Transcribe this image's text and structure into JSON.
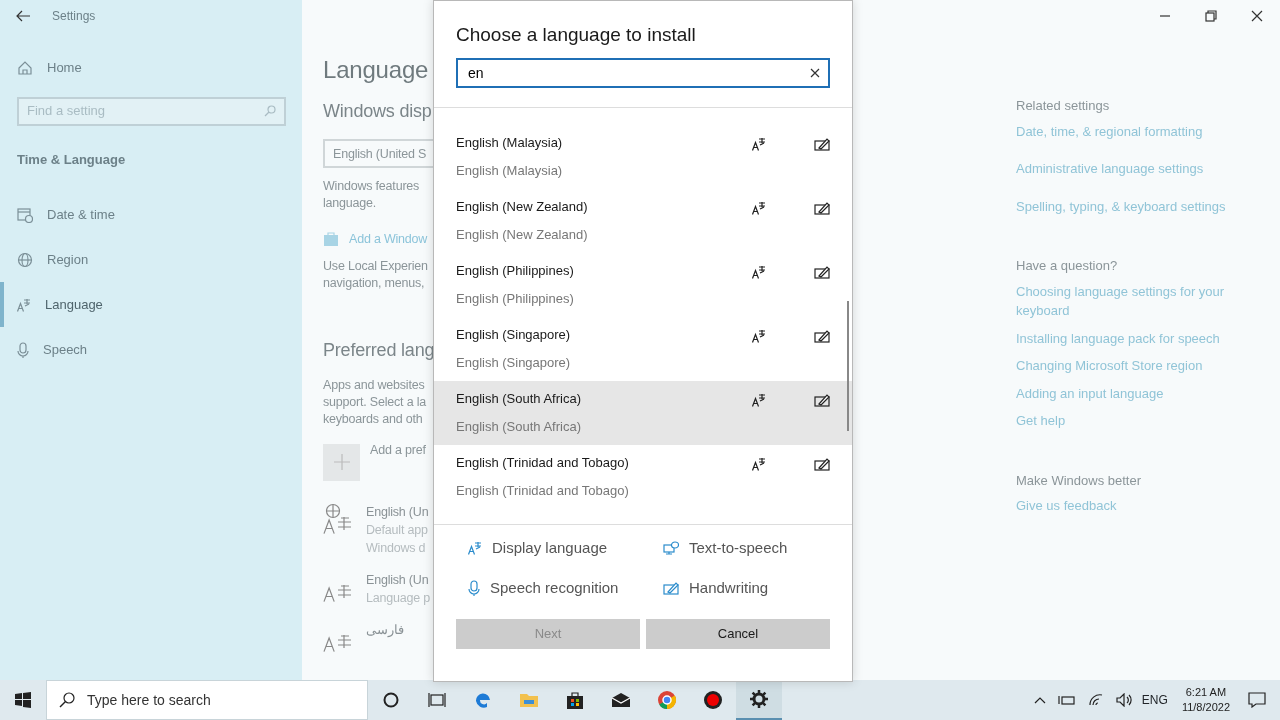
{
  "window": {
    "title": "Settings"
  },
  "sidebar": {
    "home": "Home",
    "search_placeholder": "Find a setting",
    "section": "Time & Language",
    "items": [
      {
        "label": "Date & time",
        "selected": false
      },
      {
        "label": "Region",
        "selected": false
      },
      {
        "label": "Language",
        "selected": true
      },
      {
        "label": "Speech",
        "selected": false
      }
    ]
  },
  "main": {
    "title": "Language",
    "display_heading": "Windows disp",
    "display_value": "English (United S",
    "display_note": [
      "Windows features",
      "language."
    ],
    "store_link": "Add a Window",
    "store_note": [
      "Use Local Experien",
      "navigation, menus,"
    ],
    "preferred_heading": "Preferred lang",
    "preferred_note": [
      "Apps and websites",
      "support. Select a la",
      "keyboards and oth"
    ],
    "add_label": "Add a pref",
    "preferred": [
      {
        "name": "English (Un",
        "lines": [
          "Default app",
          "Windows d"
        ]
      },
      {
        "name": "English (Un",
        "lines": [
          "Language p"
        ]
      },
      {
        "name": "فارسی"
      }
    ]
  },
  "related": [
    {
      "heading": "Related settings",
      "links": [
        "Date, time, & regional formatting",
        "Administrative language settings",
        "Spelling, typing, & keyboard settings"
      ]
    },
    {
      "heading": "Have a question?",
      "links": [
        "Choosing language settings for your keyboard",
        "Installing language pack for speech",
        "Changing Microsoft Store region",
        "Adding an input language",
        "Get help"
      ]
    },
    {
      "heading": "Make Windows better",
      "links": [
        "Give us feedback"
      ]
    }
  ],
  "dialog": {
    "title": "Choose a language to install",
    "search": {
      "value": "en"
    },
    "languages": [
      {
        "name": "English (Malaysia)",
        "native": "English (Malaysia)",
        "selected": false
      },
      {
        "name": "English (New Zealand)",
        "native": "English (New Zealand)",
        "selected": false
      },
      {
        "name": "English (Philippines)",
        "native": "English (Philippines)",
        "selected": false
      },
      {
        "name": "English (Singapore)",
        "native": "English (Singapore)",
        "selected": false
      },
      {
        "name": "English (South Africa)",
        "native": "English (South Africa)",
        "selected": true
      },
      {
        "name": "English (Trinidad and Tobago)",
        "native": "English (Trinidad and Tobago)",
        "selected": false
      }
    ],
    "legend": [
      {
        "kind": "display",
        "label": "Display language"
      },
      {
        "kind": "tts",
        "label": "Text-to-speech"
      },
      {
        "kind": "speech",
        "label": "Speech recognition"
      },
      {
        "kind": "handwriting",
        "label": "Handwriting"
      }
    ],
    "buttons": [
      {
        "label": "Next",
        "disabled": true
      },
      {
        "label": "Cancel",
        "disabled": false
      }
    ]
  },
  "taskbar": {
    "search_placeholder": "Type here to search",
    "apps": [
      {
        "kind": "cortana",
        "selected": false
      },
      {
        "kind": "taskview",
        "selected": false
      },
      {
        "kind": "edge",
        "selected": false
      },
      {
        "kind": "folder",
        "selected": false
      },
      {
        "kind": "store",
        "selected": false
      },
      {
        "kind": "mail",
        "selected": false
      },
      {
        "kind": "chrome",
        "selected": false
      },
      {
        "kind": "record",
        "selected": false
      },
      {
        "kind": "gear",
        "selected": true
      }
    ],
    "language": "ENG",
    "time": "6:21 AM",
    "date": "11/8/2022"
  }
}
